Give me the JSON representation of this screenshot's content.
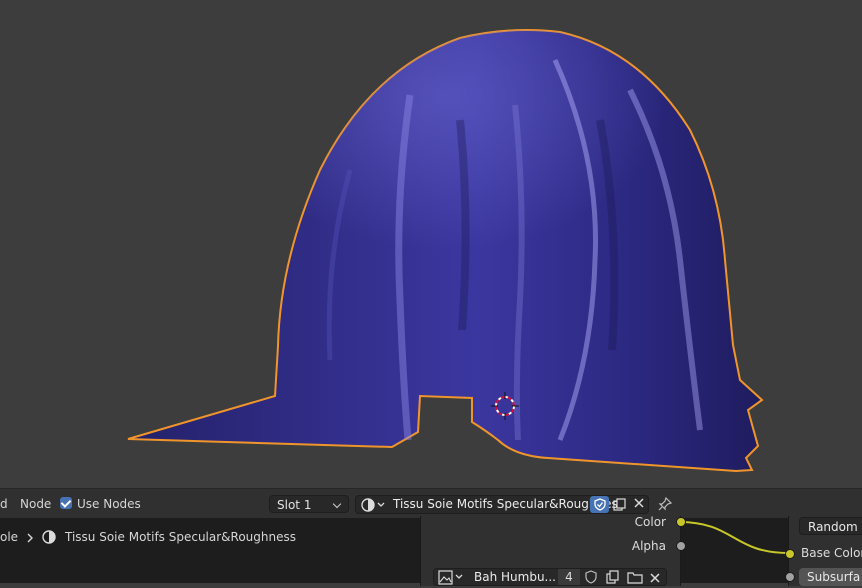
{
  "header": {
    "menu_view_partial": "d",
    "menu_node": "Node",
    "use_nodes_label": "Use Nodes",
    "use_nodes_checked": true,
    "slot_value": "Slot 1",
    "material_name": "Tissu Soie Motifs Specular&Roughness",
    "icons": {
      "material": "material-sphere-icon",
      "fake_user": "shield-check-icon",
      "duplicate": "duplicate-icon",
      "unlink": "close-icon",
      "pin": "pin-icon"
    }
  },
  "breadcrumb": {
    "object_partial": "ole",
    "material": "Tissu Soie Motifs Specular&Roughness"
  },
  "image_node": {
    "out_color": "Color",
    "out_alpha": "Alpha",
    "image_name": "Bah Humbu...",
    "users_count": "4"
  },
  "bsdf_node": {
    "random_walk_partial": "Random W",
    "base_color": "Base Color",
    "subsurface_partial": "Subsurfa"
  },
  "colors": {
    "selection_outline": "#f0952b",
    "cloth": "#2e2a7a",
    "socket_yellow": "#c7c729",
    "socket_gray": "#a1a1a1",
    "checkbox_blue": "#4772b3"
  }
}
